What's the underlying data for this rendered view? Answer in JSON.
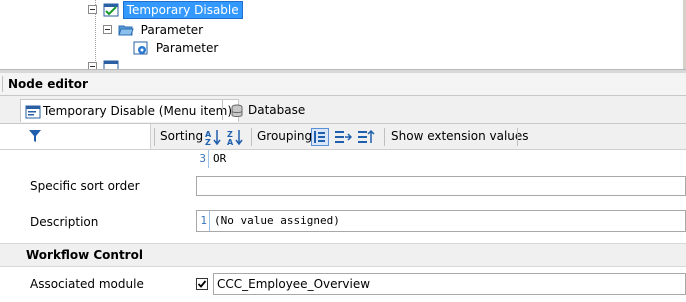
{
  "tree": {
    "items": [
      {
        "label": "Temporary Disable",
        "selected": true,
        "icon": "menu-item-check-icon"
      },
      {
        "label": "Parameter",
        "icon": "open-folder-icon"
      },
      {
        "label": "Parameter",
        "icon": "parameter-gear-icon"
      },
      {
        "label": "",
        "icon": "menu-item-icon"
      }
    ]
  },
  "editor": {
    "title": "Node editor",
    "tabs": [
      {
        "label": "Temporary Disable (Menu item)",
        "icon": "menu-item-icon",
        "active": true
      },
      {
        "label": "Database",
        "icon": "database-icon",
        "active": false
      }
    ],
    "toolbar": {
      "filter_icon": "filter-icon",
      "sorting_label": "Sorting",
      "grouping_label": "Grouping",
      "show_extension_label": "Show extension values"
    }
  },
  "properties": {
    "code_partial": {
      "line": "3",
      "text": "OR"
    },
    "specific_sort_order": {
      "label": "Specific sort order",
      "value": ""
    },
    "description": {
      "label": "Description",
      "line": "1",
      "value": "(No value assigned)"
    },
    "workflow_section": "Workflow Control",
    "associated_module": {
      "label": "Associated module",
      "checked": true,
      "value": "CCC_Employee_Overview"
    }
  },
  "colors": {
    "selection": "#3399ff",
    "panel": "#f0f0f0",
    "accent_blue": "#1f5fae"
  }
}
